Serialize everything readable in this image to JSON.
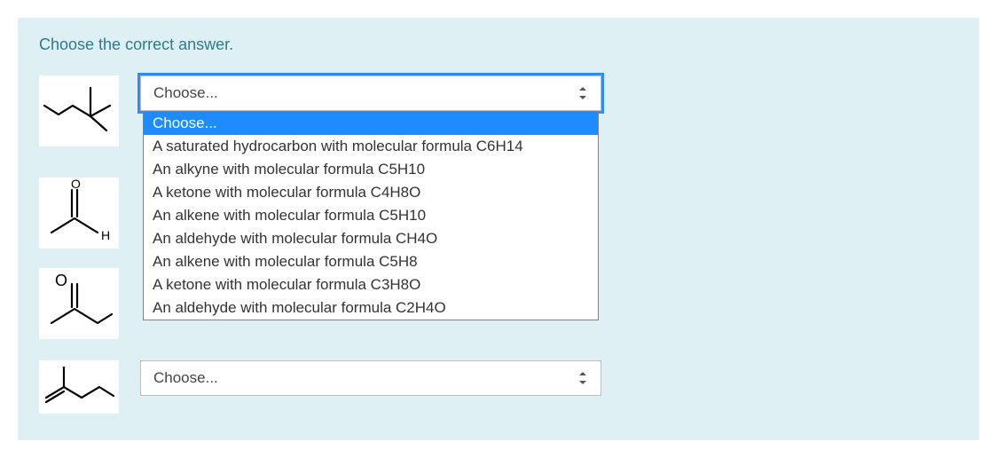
{
  "prompt": "Choose the correct answer.",
  "placeholder": "Choose...",
  "options": [
    "Choose...",
    "A saturated hydrocarbon with molecular formula C6H14",
    "An alkyne with molecular formula C5H10",
    "A ketone with molecular formula C4H8O",
    "An alkene with molecular formula C5H10",
    "An aldehyde with molecular formula CH4O",
    "An alkene with molecular formula C5H8",
    "A ketone with molecular formula C3H8O",
    "An aldehyde with molecular formula C2H4O"
  ],
  "row1": {
    "select_value": "Choose...",
    "open": true,
    "selected_index": 0
  },
  "row4": {
    "select_value": "Choose...",
    "open": false
  }
}
